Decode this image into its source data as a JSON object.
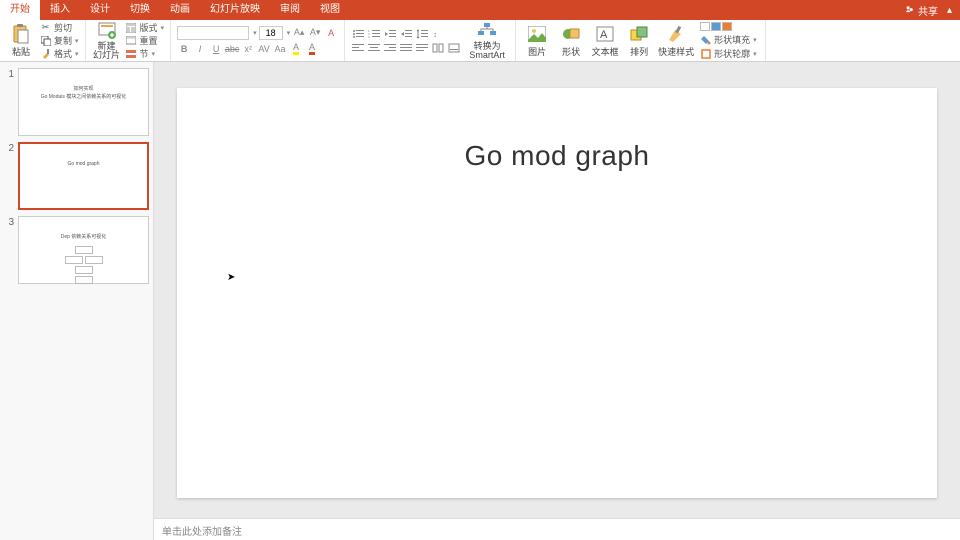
{
  "tabs": [
    "开始",
    "插入",
    "设计",
    "切换",
    "动画",
    "幻灯片放映",
    "审阅",
    "视图"
  ],
  "active_tab": 0,
  "share_label": "共享",
  "ribbon": {
    "paste": "粘贴",
    "cut": "剪切",
    "copy": "复制",
    "format_painter": "格式",
    "new_slide": "新建\n幻灯片",
    "layout": "版式",
    "reset": "重置",
    "section": "节",
    "font_name": "",
    "font_size": "18",
    "convert_smartart": "转换为\nSmartArt",
    "picture": "图片",
    "shapes": "形状",
    "textbox": "文本框",
    "arrange": "排列",
    "quick_styles": "快速样式",
    "shape_fill": "形状填充",
    "shape_outline": "形状轮廓"
  },
  "thumbs": [
    {
      "num": "1",
      "title_a": "如何实现",
      "title_b": "Go Moduis 模块之间依赖关系的可视化"
    },
    {
      "num": "2",
      "title_a": "Go mod graph"
    },
    {
      "num": "3",
      "title_a": "Dep 依赖关系可视化"
    }
  ],
  "selected_thumb": 1,
  "slide": {
    "title": "Go mod graph"
  },
  "notes_placeholder": "单击此处添加备注"
}
